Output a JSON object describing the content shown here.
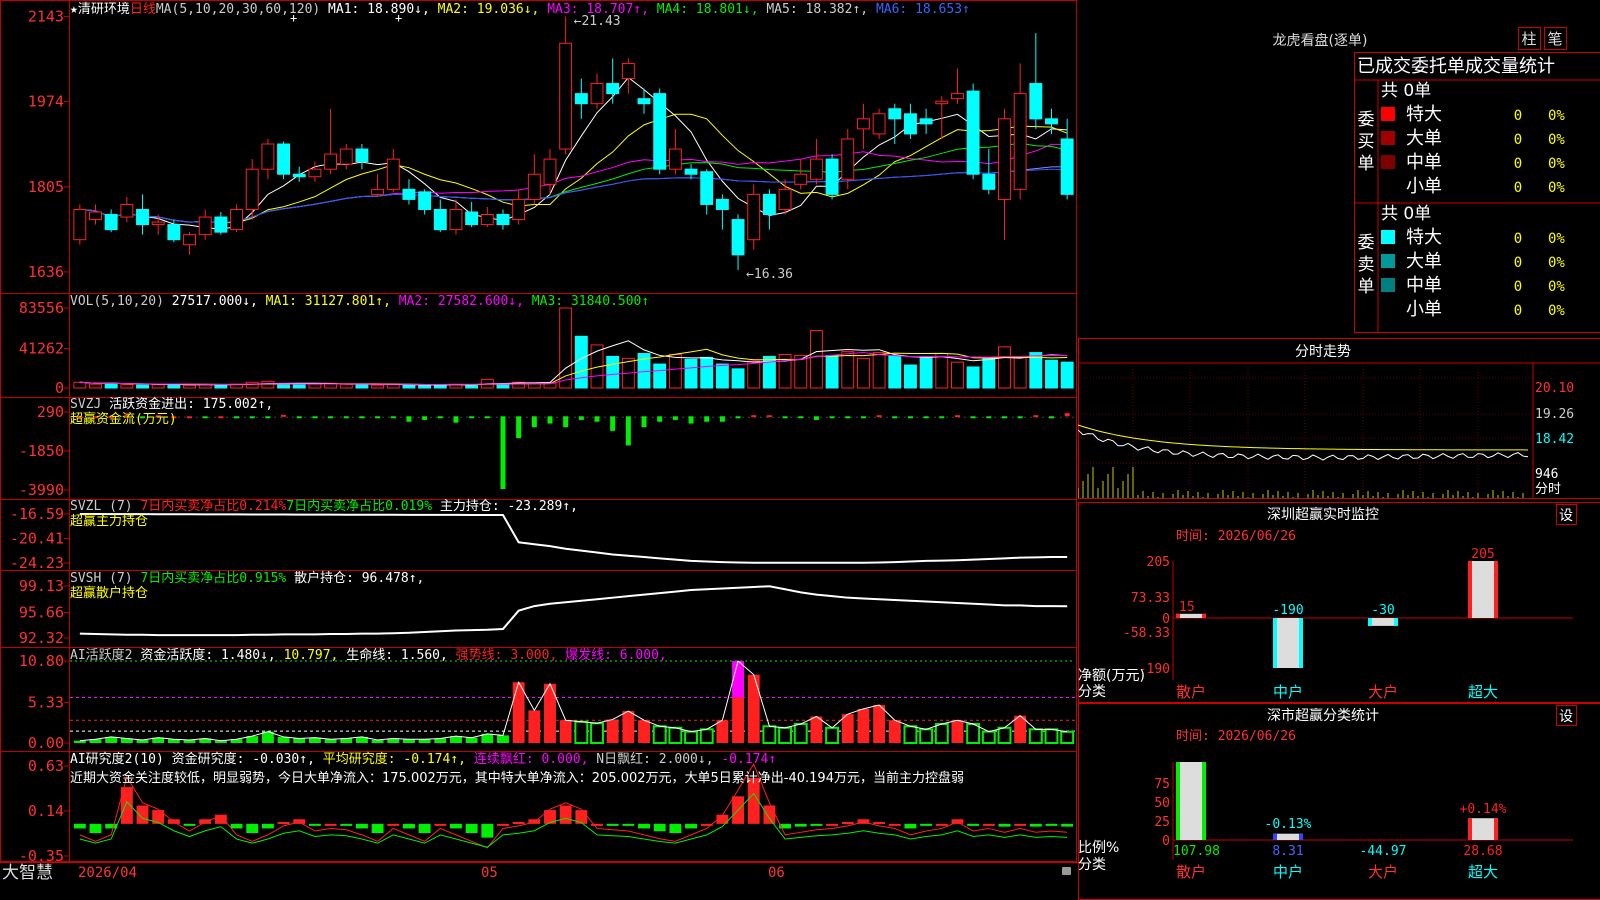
{
  "app": {
    "name": "大智慧",
    "date_start": "2026/04",
    "month_5": "05",
    "month_6": "06"
  },
  "main": {
    "star": "★",
    "stock": "清研环境",
    "period": "日线",
    "ma_text": "MA(5,10,20,30,60,120)",
    "ma1": "MA1: 18.890↓,",
    "ma2": "MA2: 19.036↓,",
    "ma3": "MA3: 18.707↑,",
    "ma4": "MA4: 18.801↓,",
    "ma5": "MA5: 18.382↑,",
    "ma6": "MA6: 18.653↑",
    "hi": "←21.43",
    "lo": "←16.36",
    "yticks": [
      "2143",
      "1974",
      "1805",
      "1636"
    ]
  },
  "vol": {
    "label": "VOL(5,10,20)",
    "v": "27517.000↓,",
    "ma1": "MA1: 31127.801↑,",
    "ma2": "MA2: 27582.600↓,",
    "ma3": "MA3: 31840.500↑",
    "yticks": [
      "83556",
      "41262",
      "0"
    ]
  },
  "svzj": {
    "label": "SVZJ",
    "t1": "活跃资金进出: 175.002↑,",
    "sub": "超赢资金流(万元)",
    "yticks": [
      "290",
      "-1850",
      "-3990"
    ]
  },
  "svzl": {
    "label": "SVZL (7)",
    "t1": "7日内买卖净占比0.214%",
    "t2": "7日内买卖净占比0.019%",
    "t3": "主力持仓: -23.289↑,",
    "sub": "超赢主力持仓",
    "yticks": [
      "-16.59",
      "-20.41",
      "-24.23"
    ]
  },
  "svsh": {
    "label": "SVSH (7)",
    "t1": "7日内买卖净占比0.915%",
    "t2": "散户持仓: 96.478↑,",
    "sub": "超赢散户持仓",
    "yticks": [
      "99.13",
      "95.66",
      "92.32"
    ]
  },
  "ai1": {
    "label": "AI活跃度2",
    "t1": "资金活跃度: 1.480↓,",
    "t2": "10.797,",
    "t3": "生命线: 1.560,",
    "t4": "强势线: 3.000,",
    "t5": "爆发线: 6.000,",
    "yticks": [
      "10.80",
      "5.33",
      "0.00"
    ]
  },
  "ai2": {
    "label": "AI研究度2(10)",
    "t1": "资金研究度: -0.030↑,",
    "t2": "平均研究度: -0.174↑,",
    "t3": "连续飘红: 0.000,",
    "t4": "N日飘红: 2.000↓,",
    "t5": "-0.174↑",
    "note": "近期大资金关注度较低，明显弱势，今日大单净流入：175.002万元，其中特大单净流入：205.002万元，大单5日累计净出-40.194万元，当前主力控盘弱",
    "yticks": [
      "0.63",
      "0.14",
      "-0.35"
    ]
  },
  "lhb": {
    "title": "龙虎看盘(逐单)",
    "btn_zhu": "柱",
    "btn_bi": "笔",
    "stats_title": "已成交委托单成交量统计",
    "buy_side": "委买单",
    "sell_side": "委卖单",
    "buy_total": "共 0单",
    "sell_total": "共 0单",
    "buy_rows": [
      {
        "name": "特大",
        "v": "0",
        "p": "0%"
      },
      {
        "name": "大单",
        "v": "0",
        "p": "0%"
      },
      {
        "name": "中单",
        "v": "0",
        "p": "0%"
      },
      {
        "name": "小单",
        "v": "0",
        "p": "0%"
      }
    ],
    "sell_rows": [
      {
        "name": "特大",
        "v": "0",
        "p": "0%"
      },
      {
        "name": "大单",
        "v": "0",
        "p": "0%"
      },
      {
        "name": "中单",
        "v": "0",
        "p": "0%"
      },
      {
        "name": "小单",
        "v": "0",
        "p": "0%"
      }
    ]
  },
  "fenshi": {
    "title": "分时走势",
    "y": [
      "20.10",
      "19.26",
      "18.42",
      "946",
      "分时"
    ]
  },
  "sz_monitor": {
    "title": "深圳超赢实时监控",
    "set": "设",
    "time": "时间: 2026/06/26",
    "yticks": [
      "205",
      "73.33",
      "0",
      "-58.33",
      "-190"
    ],
    "ylabel": "净额(万元)",
    "xlabel": "分类",
    "cats": [
      "散户",
      "中户",
      "大户",
      "超大"
    ],
    "vals": [
      "15",
      "-190",
      "-30",
      "205"
    ]
  },
  "sz_class": {
    "title": "深市超赢分类统计",
    "set": "设",
    "time": "时间: 2026/06/26",
    "yticks": [
      "75",
      "50",
      "25",
      "0"
    ],
    "ylabel": "比例%",
    "xlabel": "分类",
    "cats": [
      "散户",
      "中户",
      "大户",
      "超大"
    ],
    "vals": [
      "107.98",
      "8.31",
      "-44.97",
      "28.68"
    ],
    "tops": [
      "",
      "-0.13%",
      "",
      "+0.14%"
    ]
  },
  "chart_data": {
    "candles": [
      {
        "o": 1700,
        "c": 1760,
        "h": 1770,
        "l": 1690
      },
      {
        "o": 1740,
        "c": 1755,
        "h": 1770,
        "l": 1730
      },
      {
        "o": 1750,
        "c": 1720,
        "h": 1760,
        "l": 1715
      },
      {
        "o": 1745,
        "c": 1770,
        "h": 1785,
        "l": 1735
      },
      {
        "o": 1760,
        "c": 1730,
        "h": 1790,
        "l": 1710
      },
      {
        "o": 1730,
        "c": 1735,
        "h": 1750,
        "l": 1710
      },
      {
        "o": 1730,
        "c": 1700,
        "h": 1740,
        "l": 1695
      },
      {
        "o": 1690,
        "c": 1710,
        "h": 1715,
        "l": 1670
      },
      {
        "o": 1710,
        "c": 1745,
        "h": 1760,
        "l": 1700
      },
      {
        "o": 1745,
        "c": 1715,
        "h": 1755,
        "l": 1710
      },
      {
        "o": 1720,
        "c": 1760,
        "h": 1770,
        "l": 1715
      },
      {
        "o": 1760,
        "c": 1840,
        "h": 1860,
        "l": 1740
      },
      {
        "o": 1840,
        "c": 1890,
        "h": 1900,
        "l": 1820
      },
      {
        "o": 1890,
        "c": 1830,
        "h": 1895,
        "l": 1820
      },
      {
        "o": 1830,
        "c": 1825,
        "h": 1845,
        "l": 1815
      },
      {
        "o": 1825,
        "c": 1840,
        "h": 1855,
        "l": 1815
      },
      {
        "o": 1840,
        "c": 1870,
        "h": 1960,
        "l": 1830
      },
      {
        "o": 1850,
        "c": 1880,
        "h": 1890,
        "l": 1840
      },
      {
        "o": 1880,
        "c": 1855,
        "h": 1890,
        "l": 1840
      },
      {
        "o": 1790,
        "c": 1800,
        "h": 1830,
        "l": 1785
      },
      {
        "o": 1800,
        "c": 1860,
        "h": 1880,
        "l": 1795
      },
      {
        "o": 1800,
        "c": 1780,
        "h": 1820,
        "l": 1770
      },
      {
        "o": 1795,
        "c": 1760,
        "h": 1800,
        "l": 1750
      },
      {
        "o": 1760,
        "c": 1720,
        "h": 1780,
        "l": 1715
      },
      {
        "o": 1720,
        "c": 1760,
        "h": 1780,
        "l": 1710
      },
      {
        "o": 1755,
        "c": 1730,
        "h": 1775,
        "l": 1725
      },
      {
        "o": 1730,
        "c": 1750,
        "h": 1765,
        "l": 1725
      },
      {
        "o": 1750,
        "c": 1730,
        "h": 1760,
        "l": 1720
      },
      {
        "o": 1740,
        "c": 1780,
        "h": 1800,
        "l": 1730
      },
      {
        "o": 1780,
        "c": 1830,
        "h": 1870,
        "l": 1770
      },
      {
        "o": 1810,
        "c": 1860,
        "h": 1880,
        "l": 1790
      },
      {
        "o": 1880,
        "c": 2090,
        "h": 2143,
        "l": 1870
      },
      {
        "o": 1990,
        "c": 1970,
        "h": 2020,
        "l": 1940
      },
      {
        "o": 1970,
        "c": 2010,
        "h": 2030,
        "l": 1960
      },
      {
        "o": 2010,
        "c": 1990,
        "h": 2060,
        "l": 1970
      },
      {
        "o": 2020,
        "c": 2050,
        "h": 2060,
        "l": 1990
      },
      {
        "o": 1980,
        "c": 1970,
        "h": 2000,
        "l": 1950
      },
      {
        "o": 1990,
        "c": 1840,
        "h": 2000,
        "l": 1830
      },
      {
        "o": 1840,
        "c": 1880,
        "h": 1920,
        "l": 1830
      },
      {
        "o": 1840,
        "c": 1830,
        "h": 1850,
        "l": 1820
      },
      {
        "o": 1835,
        "c": 1770,
        "h": 1840,
        "l": 1750
      },
      {
        "o": 1780,
        "c": 1760,
        "h": 1790,
        "l": 1720
      },
      {
        "o": 1740,
        "c": 1670,
        "h": 1750,
        "l": 1640
      },
      {
        "o": 1700,
        "c": 1790,
        "h": 1810,
        "l": 1680
      },
      {
        "o": 1790,
        "c": 1750,
        "h": 1800,
        "l": 1720
      },
      {
        "o": 1760,
        "c": 1800,
        "h": 1820,
        "l": 1750
      },
      {
        "o": 1810,
        "c": 1830,
        "h": 1860,
        "l": 1800
      },
      {
        "o": 1820,
        "c": 1860,
        "h": 1900,
        "l": 1810
      },
      {
        "o": 1860,
        "c": 1790,
        "h": 1870,
        "l": 1780
      },
      {
        "o": 1820,
        "c": 1900,
        "h": 1920,
        "l": 1800
      },
      {
        "o": 1920,
        "c": 1940,
        "h": 1970,
        "l": 1880
      },
      {
        "o": 1910,
        "c": 1950,
        "h": 1960,
        "l": 1900
      },
      {
        "o": 1960,
        "c": 1940,
        "h": 1970,
        "l": 1890
      },
      {
        "o": 1950,
        "c": 1910,
        "h": 1970,
        "l": 1900
      },
      {
        "o": 1940,
        "c": 1930,
        "h": 1960,
        "l": 1910
      },
      {
        "o": 1970,
        "c": 1975,
        "h": 1985,
        "l": 1900
      },
      {
        "o": 1980,
        "c": 1990,
        "h": 2040,
        "l": 1970
      },
      {
        "o": 1995,
        "c": 1830,
        "h": 2010,
        "l": 1820
      },
      {
        "o": 1830,
        "c": 1800,
        "h": 1880,
        "l": 1790
      },
      {
        "o": 1780,
        "c": 1940,
        "h": 1960,
        "l": 1700
      },
      {
        "o": 1800,
        "c": 1990,
        "h": 2050,
        "l": 1780
      },
      {
        "o": 2010,
        "c": 1940,
        "h": 2110,
        "l": 1920
      },
      {
        "o": 1940,
        "c": 1930,
        "h": 1960,
        "l": 1910
      },
      {
        "o": 1900,
        "c": 1790,
        "h": 1940,
        "l": 1780
      }
    ],
    "volume": [
      6000,
      4000,
      5000,
      3500,
      3000,
      3500,
      4000,
      3000,
      3500,
      3000,
      4000,
      6000,
      7000,
      4000,
      3500,
      4000,
      5000,
      3800,
      3500,
      3000,
      3500,
      3200,
      3000,
      3500,
      3800,
      3000,
      9000,
      4000,
      6000,
      5000,
      5000,
      83556,
      54000,
      45000,
      33000,
      31000,
      36000,
      25000,
      35000,
      30000,
      32000,
      25000,
      20000,
      28000,
      33000,
      35000,
      34000,
      60000,
      34000,
      38000,
      31000,
      37000,
      34000,
      24000,
      33000,
      36000,
      27000,
      22000,
      31000,
      43000,
      33000,
      37000,
      29000,
      27000
    ],
    "svzj": [
      0,
      0,
      0,
      80,
      -60,
      60,
      0,
      0,
      -60,
      0,
      -40,
      -60,
      -40,
      80,
      -50,
      -40,
      -40,
      -50,
      -40,
      -80,
      -60,
      -300,
      -200,
      -60,
      -350,
      -40,
      -80,
      -3990,
      -1200,
      -600,
      -400,
      -600,
      -200,
      -300,
      -800,
      -1600,
      -600,
      -300,
      -200,
      -400,
      -300,
      -300,
      -60,
      60,
      60,
      -40,
      -60,
      -200,
      -40,
      -40,
      -60,
      60,
      -40,
      -60,
      -40,
      -60,
      60,
      -40,
      -40,
      -60,
      -40,
      60,
      -40,
      175
    ],
    "svzl": [
      -16.59,
      -16.59,
      -16.6,
      -16.6,
      -16.61,
      -16.62,
      -16.62,
      -16.63,
      -16.64,
      -16.64,
      -16.65,
      -16.66,
      -16.66,
      -16.67,
      -16.68,
      -16.68,
      -16.69,
      -16.7,
      -16.7,
      -16.71,
      -16.71,
      -16.72,
      -16.72,
      -16.73,
      -16.73,
      -16.74,
      -16.74,
      -16.75,
      -21.0,
      -21.3,
      -21.6,
      -22.0,
      -22.3,
      -22.6,
      -22.9,
      -23.1,
      -23.3,
      -23.5,
      -23.7,
      -23.9,
      -24.0,
      -24.1,
      -24.15,
      -24.2,
      -24.2,
      -24.2,
      -24.2,
      -24.2,
      -24.2,
      -24.2,
      -24.2,
      -24.15,
      -24.1,
      -24.0,
      -23.9,
      -23.85,
      -23.8,
      -23.7,
      -23.6,
      -23.5,
      -23.4,
      -23.35,
      -23.3,
      -23.289
    ],
    "svsh": [
      92.9,
      92.85,
      92.8,
      92.75,
      92.75,
      92.7,
      92.7,
      92.7,
      92.7,
      92.7,
      92.7,
      92.75,
      92.75,
      92.8,
      92.8,
      92.8,
      92.85,
      92.85,
      92.9,
      92.9,
      92.95,
      93.0,
      93.1,
      93.2,
      93.3,
      93.35,
      93.4,
      93.5,
      95.9,
      96.5,
      96.8,
      97.0,
      97.2,
      97.4,
      97.6,
      97.8,
      98.0,
      98.2,
      98.4,
      98.6,
      98.7,
      98.8,
      98.9,
      99.0,
      99.1,
      98.7,
      98.3,
      98.0,
      97.8,
      97.6,
      97.5,
      97.4,
      97.3,
      97.2,
      97.1,
      97.0,
      96.9,
      96.8,
      96.7,
      96.6,
      96.6,
      96.5,
      96.5,
      96.478
    ],
    "ai1": [
      0.3,
      0.5,
      0.8,
      0.6,
      0.4,
      0.7,
      0.5,
      0.4,
      0.6,
      0.3,
      0.5,
      0.9,
      1.5,
      0.8,
      0.6,
      0.7,
      0.5,
      0.6,
      0.8,
      0.4,
      0.6,
      0.5,
      0.5,
      0.6,
      0.9,
      0.7,
      1.2,
      1.0,
      8.0,
      4.3,
      7.8,
      3.0,
      2.8,
      2.6,
      3.1,
      4.2,
      3.0,
      2.2,
      2.0,
      1.5,
      1.8,
      3.0,
      10.8,
      9.0,
      2.2,
      2.0,
      2.5,
      3.5,
      2.0,
      3.8,
      4.5,
      5.0,
      3.0,
      2.2,
      1.8,
      2.5,
      3.0,
      2.5,
      1.5,
      2.0,
      3.6,
      1.8,
      1.8,
      1.48
    ],
    "ai2": [
      -0.05,
      -0.1,
      -0.05,
      0.4,
      0.2,
      0.15,
      0.05,
      -0.02,
      0.05,
      0.1,
      -0.05,
      -0.1,
      -0.05,
      0.02,
      0.05,
      -0.02,
      0.0,
      -0.01,
      -0.05,
      -0.1,
      0.0,
      -0.05,
      -0.1,
      0.0,
      -0.05,
      -0.1,
      -0.15,
      0.0,
      0.02,
      0.05,
      0.15,
      0.2,
      0.15,
      0.0,
      -0.01,
      -0.02,
      -0.05,
      -0.08,
      -0.1,
      -0.05,
      0.0,
      0.1,
      0.3,
      0.5,
      0.2,
      -0.05,
      -0.03,
      -0.01,
      0.0,
      0.02,
      0.05,
      0.02,
      0.0,
      -0.05,
      -0.02,
      0.0,
      0.05,
      -0.02,
      0.0,
      -0.03,
      0.0,
      -0.03,
      -0.02,
      -0.03
    ]
  }
}
